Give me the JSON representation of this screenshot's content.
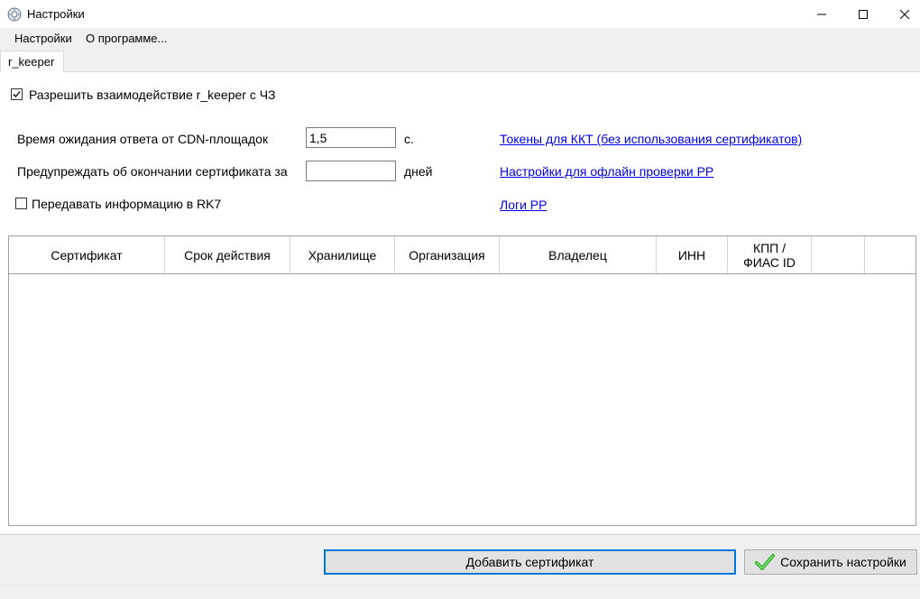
{
  "window": {
    "title": "Настройки",
    "icon": "gear-globe-icon",
    "controls": {
      "minimize": "minimize-icon",
      "maximize": "maximize-icon",
      "close": "close-icon"
    }
  },
  "menu": {
    "items": [
      {
        "label": "Настройки"
      },
      {
        "label": "О программе..."
      }
    ]
  },
  "tabs": [
    {
      "label": "r_keeper",
      "active": true
    }
  ],
  "form": {
    "allow_interaction": {
      "label": "Разрешить взаимодействие r_keeper с ЧЗ",
      "checked": true
    },
    "cdn_timeout": {
      "label": "Время ожидания ответа от CDN-площадок",
      "value": "1,5",
      "unit": "с."
    },
    "cert_warning": {
      "label": "Предупреждать об окончании сертификата за",
      "value": "",
      "unit": "дней"
    },
    "send_rk7": {
      "label": "Передавать информацию в RK7",
      "checked": false
    }
  },
  "links": {
    "tokens": "Токены для ККТ (без использования сертификатов)",
    "offline": "Настройки для офлайн проверки РР",
    "logs": "Логи РР"
  },
  "table": {
    "columns": [
      {
        "label": "Сертификат"
      },
      {
        "label": "Срок действия"
      },
      {
        "label": "Хранилище"
      },
      {
        "label": "Организация"
      },
      {
        "label": "Владелец"
      },
      {
        "label": "ИНН"
      },
      {
        "label": "КПП /\nФИАС ID"
      },
      {
        "label": ""
      },
      {
        "label": ""
      }
    ],
    "rows": []
  },
  "buttons": {
    "add_certificate": "Добавить сертификат",
    "save_settings": "Сохранить настройки"
  },
  "colors": {
    "link": "#0000ee",
    "accent_border": "#0078d7",
    "save_check": "#2eae2a"
  }
}
